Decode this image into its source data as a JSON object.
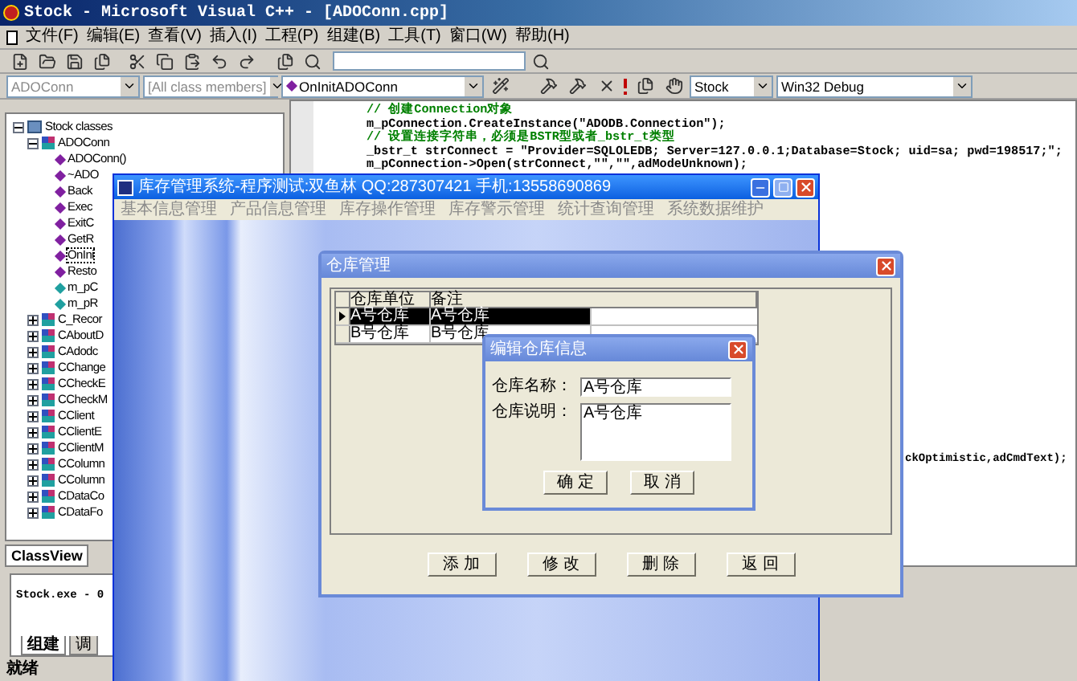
{
  "ide": {
    "title": "Stock - Microsoft Visual C++ - [ADOConn.cpp]",
    "menu": [
      "文件(F)",
      "编辑(E)",
      "查看(V)",
      "插入(I)",
      "工程(P)",
      "组建(B)",
      "工具(T)",
      "窗口(W)",
      "帮助(H)"
    ],
    "combos": [
      {
        "kind": "class",
        "value": "ADOConn",
        "disabled": true
      },
      {
        "kind": "filter",
        "value": "[All class members]",
        "disabled": true
      },
      {
        "kind": "member",
        "value": "OnInitADOConn",
        "disabled": false
      },
      {
        "kind": "project",
        "value": "Stock",
        "disabled": false
      },
      {
        "kind": "config",
        "value": "Win32 Debug",
        "disabled": false
      }
    ],
    "class_tree": [
      {
        "label": "Stock classes",
        "kind": "root",
        "expanded": true,
        "selected": false,
        "children": [
          {
            "label": "ADOConn",
            "kind": "class",
            "expanded": true,
            "selected": false,
            "children": [
              {
                "label": "ADOConn()",
                "kind": "method",
                "selected": false
              },
              {
                "label": "~ADO",
                "kind": "method",
                "selected": false
              },
              {
                "label": "Back",
                "kind": "method",
                "selected": false
              },
              {
                "label": "Exec",
                "kind": "method",
                "selected": false
              },
              {
                "label": "ExitC",
                "kind": "method",
                "selected": false
              },
              {
                "label": "GetR",
                "kind": "method",
                "selected": false
              },
              {
                "label": "OnIni",
                "kind": "method",
                "selected": true
              },
              {
                "label": "Resto",
                "kind": "method",
                "selected": false
              },
              {
                "label": "m_pC",
                "kind": "member",
                "selected": false
              },
              {
                "label": "m_pR",
                "kind": "member",
                "selected": false
              }
            ]
          },
          {
            "label": "C_Recor",
            "kind": "class",
            "expanded": false,
            "selected": false
          },
          {
            "label": "CAboutD",
            "kind": "class",
            "expanded": false,
            "selected": false
          },
          {
            "label": "CAdodc",
            "kind": "class",
            "expanded": false,
            "selected": false
          },
          {
            "label": "CChange",
            "kind": "class",
            "expanded": false,
            "selected": false
          },
          {
            "label": "CCheckE",
            "kind": "class",
            "expanded": false,
            "selected": false
          },
          {
            "label": "CCheckM",
            "kind": "class",
            "expanded": false,
            "selected": false
          },
          {
            "label": "CClient",
            "kind": "class",
            "expanded": false,
            "selected": false
          },
          {
            "label": "CClientE",
            "kind": "class",
            "expanded": false,
            "selected": false
          },
          {
            "label": "CClientM",
            "kind": "class",
            "expanded": false,
            "selected": false
          },
          {
            "label": "CColumn",
            "kind": "class",
            "expanded": false,
            "selected": false
          },
          {
            "label": "CColumn",
            "kind": "class",
            "expanded": false,
            "selected": false
          },
          {
            "label": "CDataCo",
            "kind": "class",
            "expanded": false,
            "selected": false
          },
          {
            "label": "CDataFo",
            "kind": "class",
            "expanded": false,
            "selected": false
          }
        ]
      }
    ],
    "workspace_tabs": [
      {
        "label": "ClassView",
        "selected": true
      }
    ],
    "code_lines": [
      {
        "kind": "comment",
        "text": "// 创建Connection对象"
      },
      {
        "kind": "code",
        "text": "m_pConnection.CreateInstance(\"ADODB.Connection\");"
      },
      {
        "kind": "comment",
        "text": "// 设置连接字符串，必须是BSTR型或者_bstr_t类型"
      },
      {
        "kind": "code",
        "text": "_bstr_t strConnect = \"Provider=SQLOLEDB; Server=127.0.0.1;Database=Stock; uid=sa; pwd=198517;\";"
      },
      {
        "kind": "code",
        "text": "m_pConnection->Open(strConnect,\"\",\"\",adModeUnknown);"
      }
    ],
    "code_tail": "ckOptimistic,adCmdText);",
    "output": {
      "text": "Stock.exe - 0",
      "tabs": [
        {
          "label": "组建",
          "selected": true
        },
        {
          "label": "调",
          "selected": false
        }
      ]
    },
    "status_bar": "就绪"
  },
  "app_window": {
    "title": "库存管理系统-程序测试:双鱼林 QQ:287307421 手机:13558690869",
    "menu": [
      "基本信息管理",
      "产品信息管理",
      "库存操作管理",
      "库存警示管理",
      "统计查询管理",
      "系统数据维护"
    ]
  },
  "warehouse_dialog": {
    "title": "仓库管理",
    "columns": [
      "仓库单位",
      "备注"
    ],
    "rows": [
      {
        "cells": [
          "A号仓库",
          "A号仓库"
        ],
        "selected": true
      },
      {
        "cells": [
          "B号仓库",
          "B号仓库"
        ],
        "selected": false
      }
    ],
    "buttons": [
      "添 加",
      "修 改",
      "删 除",
      "返 回"
    ]
  },
  "edit_dialog": {
    "title": "编辑仓库信息",
    "fields": [
      {
        "kind": "line",
        "label": "仓库名称：",
        "value": "A号仓库"
      },
      {
        "kind": "area",
        "label": "仓库说明：",
        "value": "A号仓库"
      }
    ],
    "buttons": [
      "确 定",
      "取 消"
    ]
  }
}
